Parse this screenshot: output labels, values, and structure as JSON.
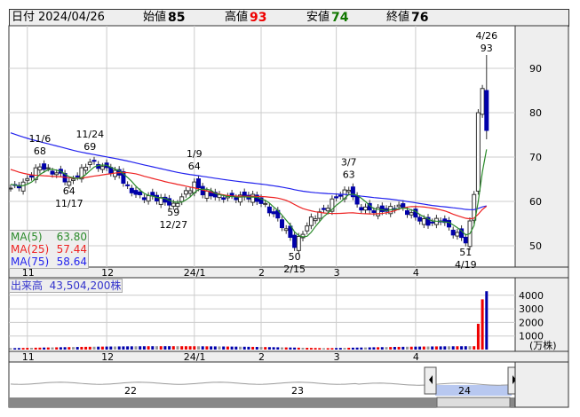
{
  "header": {
    "date_label": "日付",
    "date": "2024/04/26",
    "open_label": "始値",
    "open": "85",
    "high_label": "高値",
    "high": "93",
    "low_label": "安値",
    "low": "74",
    "close_label": "終値",
    "close": "76"
  },
  "colors": {
    "up": "#e00",
    "down": "#00a",
    "ma5": "#2a8a2a",
    "ma25": "#e22",
    "ma75": "#22e",
    "nav": "#b8c8f0"
  },
  "ma_legend": [
    {
      "label": "MA(5)",
      "value": "63.80"
    },
    {
      "label": "MA(25)",
      "value": "57.44"
    },
    {
      "label": "MA(75)",
      "value": "58.64"
    }
  ],
  "volume": {
    "label": "出来高",
    "value": "43,504,200株",
    "unit": "(万株)",
    "ticks": [
      "4000",
      "3000",
      "2000",
      "1000"
    ]
  },
  "navigator": {
    "years": [
      "22",
      "23",
      "24"
    ]
  },
  "chart_data": {
    "type": "candlestick",
    "y_ticks": [
      90,
      80,
      70,
      60,
      50
    ],
    "ylim": [
      47,
      96
    ],
    "month_labels": [
      {
        "i": 4,
        "label": "11"
      },
      {
        "i": 23,
        "label": "12"
      },
      {
        "i": 44,
        "label": "24/1"
      },
      {
        "i": 60,
        "label": "2"
      },
      {
        "i": 78,
        "label": "3"
      },
      {
        "i": 97,
        "label": "4"
      }
    ],
    "close_path": [
      [
        0,
        63
      ],
      [
        3,
        64
      ],
      [
        5,
        66
      ],
      [
        7,
        68
      ],
      [
        9,
        67
      ],
      [
        12,
        66
      ],
      [
        14,
        64
      ],
      [
        16,
        66
      ],
      [
        18,
        68
      ],
      [
        19,
        69
      ],
      [
        21,
        68
      ],
      [
        24,
        67
      ],
      [
        26,
        66
      ],
      [
        28,
        63
      ],
      [
        31,
        61
      ],
      [
        34,
        61
      ],
      [
        37,
        60
      ],
      [
        39,
        59
      ],
      [
        41,
        61
      ],
      [
        43,
        63
      ],
      [
        44,
        64
      ],
      [
        46,
        62
      ],
      [
        50,
        61
      ],
      [
        55,
        61
      ],
      [
        58,
        61
      ],
      [
        61,
        59
      ],
      [
        64,
        56
      ],
      [
        67,
        52
      ],
      [
        68,
        50
      ],
      [
        70,
        53
      ],
      [
        72,
        56
      ],
      [
        75,
        58
      ],
      [
        78,
        61
      ],
      [
        80,
        62
      ],
      [
        81,
        63
      ],
      [
        83,
        59
      ],
      [
        86,
        58
      ],
      [
        90,
        58
      ],
      [
        93,
        59
      ],
      [
        96,
        57
      ],
      [
        100,
        55
      ],
      [
        103,
        56
      ],
      [
        106,
        53
      ],
      [
        108,
        52
      ],
      [
        109,
        51
      ],
      [
        110,
        55
      ],
      [
        111,
        62
      ],
      [
        112,
        80
      ],
      [
        113,
        85
      ],
      [
        114,
        76
      ]
    ],
    "annotations": [
      {
        "i": 7,
        "top": "11/6",
        "value": "68",
        "pos": "above"
      },
      {
        "i": 14,
        "top": "64",
        "value": "11/17",
        "pos": "below"
      },
      {
        "i": 19,
        "top": "11/24",
        "value": "69",
        "pos": "above"
      },
      {
        "i": 39,
        "top": "59",
        "value": "12/27",
        "pos": "below"
      },
      {
        "i": 44,
        "top": "1/9",
        "value": "64",
        "pos": "above"
      },
      {
        "i": 68,
        "top": "50",
        "value": "2/15",
        "pos": "below"
      },
      {
        "i": 81,
        "top": "3/7",
        "value": "63",
        "pos": "above"
      },
      {
        "i": 109,
        "top": "51",
        "value": "4/19",
        "pos": "below"
      },
      {
        "i": 114,
        "top": "4/26",
        "value": "93",
        "pos": "above"
      }
    ],
    "last": {
      "open": 85,
      "high": 93,
      "low": 74,
      "close": 76
    },
    "volume_last": [
      3700,
      4300
    ]
  }
}
